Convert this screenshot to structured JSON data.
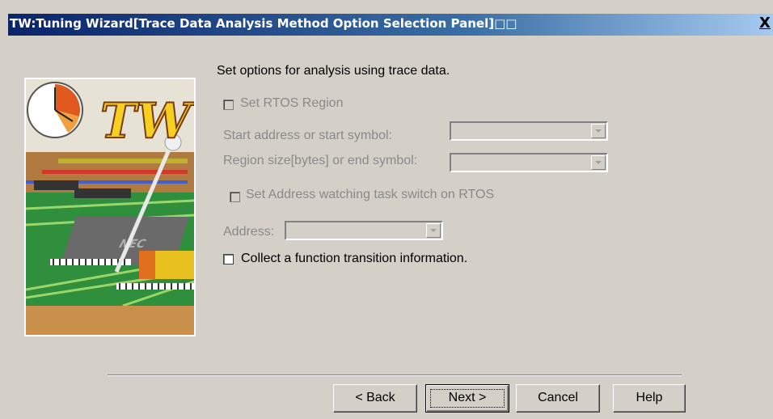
{
  "window": {
    "title": "TW:Tuning Wizard[Trace Data Analysis Method Option Selection Panel]□□",
    "close_label": "X"
  },
  "panel": {
    "heading": "Set options for analysis using trace data.",
    "rtos_region": {
      "label": "Set RTOS Region",
      "checked": false,
      "enabled": false
    },
    "start_address": {
      "label": "Start address or start symbol:",
      "value": "",
      "enabled": false
    },
    "region_size": {
      "label": "Region size[bytes] or end symbol:",
      "value": "",
      "enabled": false
    },
    "address_watching": {
      "label": "Set Address watching task switch on RTOS",
      "checked": false,
      "enabled": false
    },
    "address": {
      "label": "Address:",
      "value": "",
      "enabled": false
    },
    "function_transition": {
      "label": "Collect a function transition information.",
      "checked": false,
      "enabled": true
    }
  },
  "artwork": {
    "logo_text": "TW",
    "chip_text": "NEC"
  },
  "buttons": {
    "back": "< Back",
    "next": "Next >",
    "cancel": "Cancel",
    "help": "Help"
  }
}
